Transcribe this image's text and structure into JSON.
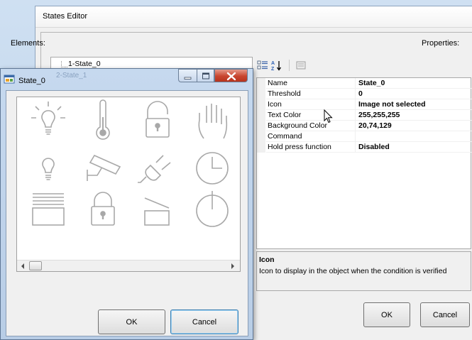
{
  "states_editor": {
    "title": "States Editor",
    "elements_label": "Elements:",
    "properties_label": "Properties:",
    "tree_items": [
      "1-State_0",
      "2-State_1"
    ],
    "properties": [
      {
        "name": "Name",
        "value": "State_0"
      },
      {
        "name": "Threshold",
        "value": "0"
      },
      {
        "name": "Icon",
        "value": "Image not selected"
      },
      {
        "name": "Text Color",
        "value": "255,255,255"
      },
      {
        "name": "Background Color",
        "value": "20,74,129"
      },
      {
        "name": "Command",
        "value": ""
      },
      {
        "name": "Hold press function",
        "value": "Disabled"
      }
    ],
    "description": {
      "title": "Icon",
      "text": "Icon to display in the object when the condition is verified"
    },
    "ok_label": "OK",
    "cancel_label": "Cancel"
  },
  "dialog": {
    "title": "State_0",
    "ghost_title": "2-State_1",
    "icons": [
      "light-bulb-on-icon",
      "thermometer-icon",
      "padlock-open-icon",
      "hand-icon",
      "light-bulb-icon",
      "security-camera-icon",
      "power-plug-icon",
      "clock-icon",
      "blinds-icon",
      "padlock-closed-icon",
      "gate-icon",
      "power-icon"
    ],
    "ok_label": "OK",
    "cancel_label": "Cancel"
  }
}
